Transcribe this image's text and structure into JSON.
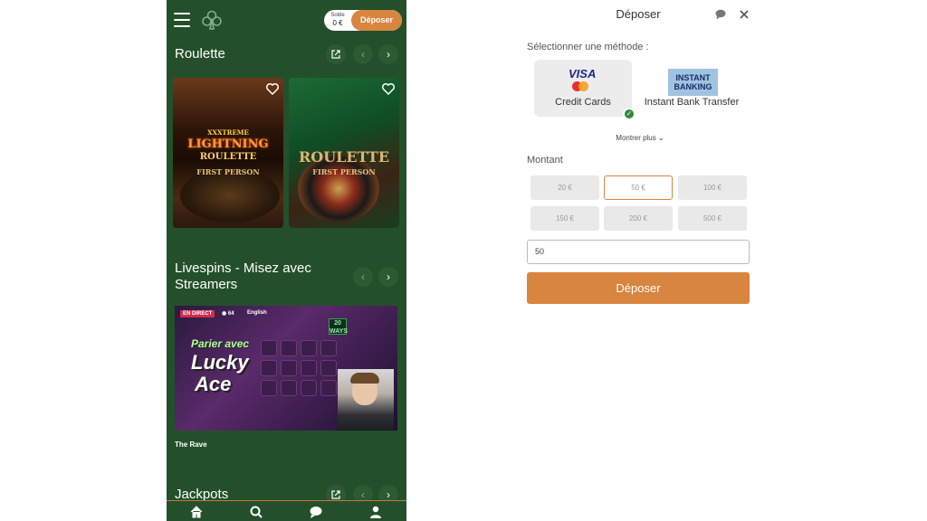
{
  "casino": {
    "balance_label": "Solde",
    "balance_value": "0 €",
    "deposit_button": "Déposer",
    "sections": {
      "roulette": {
        "title": "Roulette"
      },
      "livespins": {
        "title_line1": "Livespins - Misez avec",
        "title_line2": "Streamers"
      },
      "jackpots": {
        "title": "Jackpots"
      }
    },
    "games": [
      {
        "title_top": "XXXTREME",
        "title_main": "LIGHTNING",
        "title_sub": "ROULETTE",
        "title_person": "FIRST PERSON"
      },
      {
        "title_main": "ROULETTE",
        "title_person": "FIRST PERSON"
      }
    ],
    "stream": {
      "live_badge": "EN DIRECT",
      "viewers": "64",
      "language": "English",
      "line1": "Parier avec",
      "line2": "Lucky",
      "line3": "Ace",
      "ways_badge": "20 WAYS",
      "name": "The Rave"
    }
  },
  "deposit": {
    "title": "Déposer",
    "select_method_label": "Sélectionner une méthode :",
    "methods": [
      {
        "name": "Credit Cards",
        "logo": "VISA",
        "selected": true
      },
      {
        "name": "Instant Bank Transfer",
        "logo": "INSTANT BANKING",
        "selected": false
      }
    ],
    "show_more": "Montrer plus",
    "amount_label": "Montant",
    "amounts": [
      "20 €",
      "50 €",
      "100 €",
      "150 €",
      "200 €",
      "500 €"
    ],
    "selected_amount": "50 €",
    "amount_value": "50",
    "submit": "Déposer",
    "accent_color": "#d8853f",
    "check_color": "#2e8a3a"
  }
}
